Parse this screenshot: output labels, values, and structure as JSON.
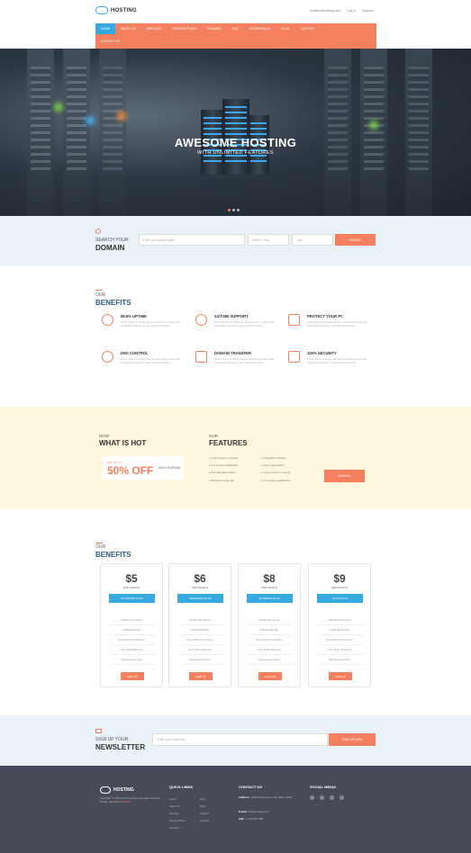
{
  "brand": "HOSTING",
  "toplinks": [
    "info@webhosting.com",
    "Log in",
    "Register"
  ],
  "nav": {
    "row1": [
      "HOME",
      "ABOUT US",
      "SERVICES",
      "HOSTING PLANS",
      "DOMAINS",
      "FAQ",
      "TESTIMONIALS",
      "BLOG",
      "SUPPORT"
    ],
    "row2": [
      "CONTACT US"
    ],
    "active_index": 0
  },
  "hero": {
    "title": "AWESOME HOSTING",
    "subtitle": "WITH UNLIMITED FEATURES"
  },
  "search": {
    "label_small": "SEARCH YOUR",
    "label_big": "DOMAIN",
    "placeholder": "Enter your domain name",
    "select1": "Select 1 Year",
    "select2": ".com",
    "button": "SEARCH"
  },
  "benefits": {
    "small": "OUR",
    "big": "BENEFITS",
    "items": [
      {
        "title": "99.9% UPTIME",
        "text": "Lorem ipsum is simply dummy text of the printing and typesetting industry. Lorem ipsum has been"
      },
      {
        "title": "24/7/365 SUPPORT",
        "text": "Lorem ipsum is simply dummy text of the printing and typesetting industry. Lorem ipsum has been"
      },
      {
        "title": "PROTECT YOUR PC",
        "text": "Lorem ipsum is simply dummy text of the printing and typesetting industry. Lorem ipsum has been"
      },
      {
        "title": "DNS CONTROL",
        "text": "Lorem ipsum is simply dummy text of the printing and typesetting industry. Lorem ipsum has been"
      },
      {
        "title": "DOMAIN TRANSFER",
        "text": "Lorem ipsum is simply dummy text of the printing and typesetting industry. Lorem ipsum has been"
      },
      {
        "title": "100% SECURITY",
        "text": "Lorem ipsum is simply dummy text of the printing and typesetting industry. Lorem ipsum has been"
      }
    ]
  },
  "hot": {
    "small": "NOW",
    "big": "WHAT IS HOT",
    "offer_up": "GET UP TO",
    "offer_pct": "50% OFF",
    "offer_each": "EACH HOSTING",
    "features_small": "OUR",
    "features_big": "FEATURES",
    "features": [
      "Lorem ipsum is simply",
      "It is a long established",
      "The standard chunk",
      "Pharetra neque feu",
      "Integration solution",
      "Ipsum generators",
      "Lorem ipsum is simply",
      "It is a long established"
    ],
    "button": "VIEW ALL"
  },
  "pricing": {
    "small": "OUR",
    "big": "BENEFITS",
    "plans": [
      {
        "price": "$5",
        "per": "PER MONTH",
        "name": "STANDARD PLAN",
        "features": [
          "10GB Disk Space",
          "1TB Bandwidth",
          "Free DDoS Protection",
          "Free Daily Backups",
          "Managed Hosting"
        ],
        "button": "SIGN UP"
      },
      {
        "price": "$6",
        "per": "PER MONTH",
        "name": "ADVANCED PLAN",
        "features": [
          "20GB Disk Space",
          "2TB Bandwidth",
          "Free DDoS Protection",
          "Free Daily Backups",
          "Managed Hosting"
        ],
        "button": "SIGN UP"
      },
      {
        "price": "$8",
        "per": "PER MONTH",
        "name": "BUSINESS PLAN",
        "features": [
          "50GB Disk Space",
          "5TB Bandwidth",
          "Free DDoS Protection",
          "Free Daily Backups",
          "Managed Hosting"
        ],
        "button": "SIGN UP"
      },
      {
        "price": "$9",
        "per": "PER MONTH",
        "name": "GOLD PLAN",
        "features": [
          "100GB Disk Space",
          "10TB Bandwidth",
          "Free DDoS Protection",
          "Free Daily Backups",
          "Managed Hosting"
        ],
        "button": "SIGN UP"
      }
    ]
  },
  "newsletter": {
    "small": "SIGN UP YOUR",
    "big": "NEWSLETTER",
    "placeholder": "Enter your email here",
    "button": "SIGN UP NOW"
  },
  "footer": {
    "brand": "HOSTING",
    "copy_text": "Copyright © 2016 Company Name All rights reserved. Design: Template",
    "copy_link": "PHLOKS",
    "quick_links_title": "QUICK LINKS",
    "links_col1": [
      "Home",
      "About Us",
      "Services",
      "Hosting Plans",
      "Domains"
    ],
    "links_col2": [
      "FAQ",
      "Blog",
      "Support",
      "Contact"
    ],
    "contact_title": "CONTACT US",
    "contact_address_label": "Address :",
    "contact_address": "1234 Street Name, City, State 12345",
    "contact_email_label": "E-mail :",
    "contact_email": "info@hosting.com",
    "contact_phone_label": "Call :",
    "contact_phone": "+1 234 567 890",
    "social_title": "SOCIAL MEDIA",
    "social": [
      "f",
      "t",
      "in",
      "g"
    ]
  },
  "colors": {
    "accent": "#f4805f",
    "blue": "#36a9e1",
    "footer": "#474b57"
  }
}
